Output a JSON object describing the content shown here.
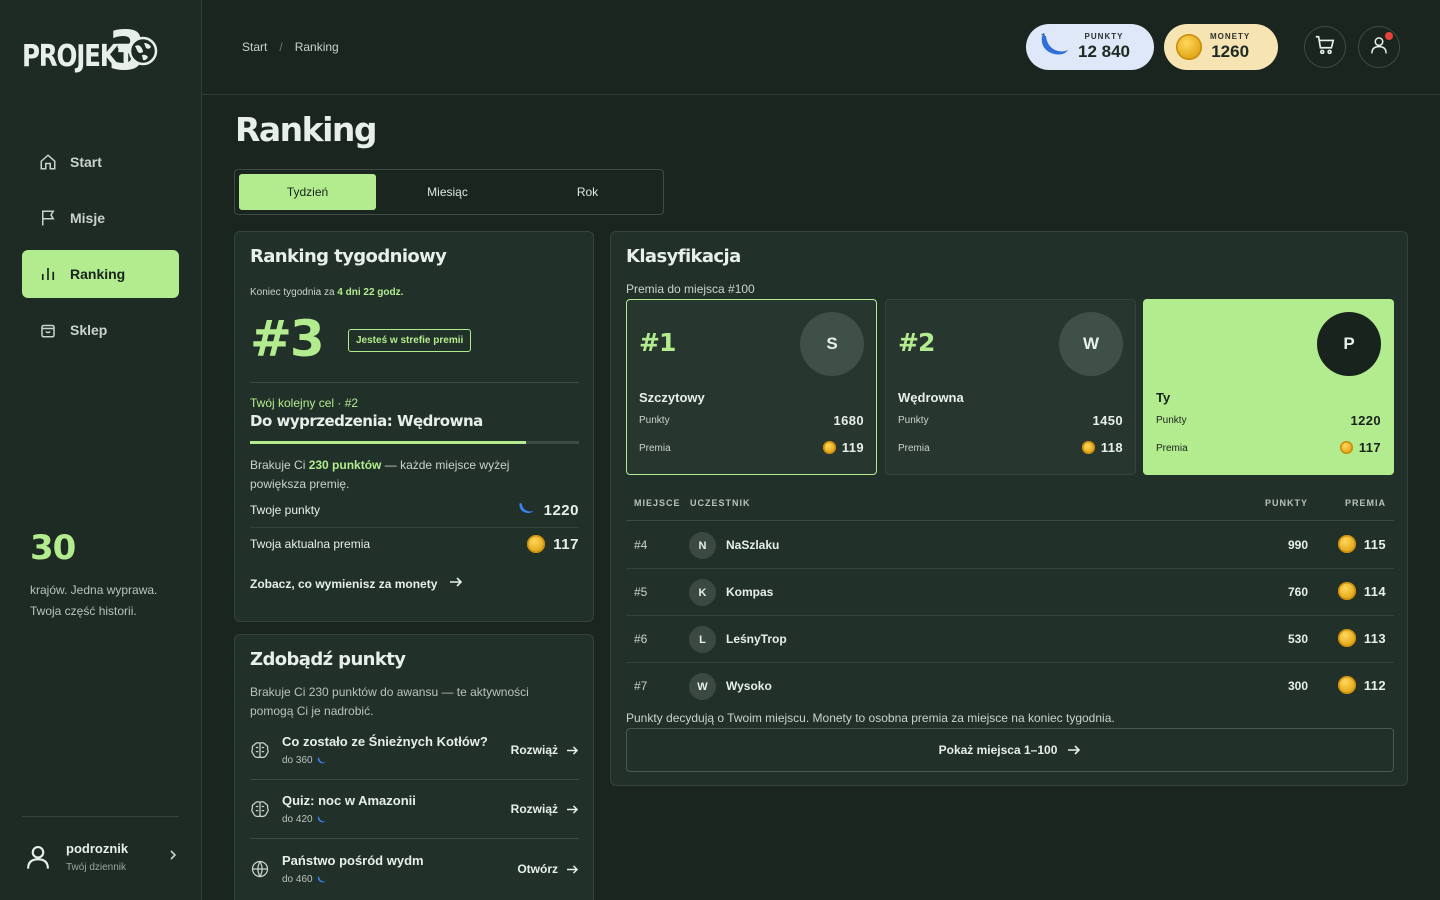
{
  "logo": {
    "text": "PROJEKT",
    "num": "3"
  },
  "nav": [
    {
      "label": "Start",
      "icon": "home-icon"
    },
    {
      "label": "Misje",
      "icon": "flag-icon"
    },
    {
      "label": "Ranking",
      "icon": "bar-chart-icon"
    },
    {
      "label": "Sklep",
      "icon": "shopping-bag-icon"
    }
  ],
  "promo": {
    "number": "30",
    "text": "krajów. Jedna wyprawa. Twoja część historii."
  },
  "user": {
    "name": "podroznik",
    "sub": "Twój dziennik"
  },
  "breadcrumb": {
    "home": "Start",
    "sep": "/",
    "current": "Ranking"
  },
  "wallet": {
    "points_label": "PUNKTY",
    "points": "12 840",
    "coins_label": "MONETY",
    "coins": "1260"
  },
  "page": {
    "title": "Ranking"
  },
  "tabs": [
    "Tydzień",
    "Miesiąc",
    "Rok"
  ],
  "weekly": {
    "title": "Ranking tygodniowy",
    "ends_prefix": "Koniec tygodnia za",
    "ends_value": "4 dni 22 godz.",
    "rank": "#3",
    "zone_badge": "Jesteś w strefie premii",
    "goal_label": "Twój kolejny cel · #2",
    "goal": "Do wyprzedzenia: Wędrowna",
    "progress": 0.84,
    "missing_prefix": "Brakuje Ci",
    "missing_value": "230 punktów",
    "missing_suffix": "— każde miejsce wyżej powiększa premię.",
    "points_label": "Twoje punkty",
    "points": "1220",
    "bonus_label": "Twoja aktualna premia",
    "bonus": "117",
    "link": "Zobacz, co wymienisz za monety"
  },
  "earn": {
    "title": "Zdobądź punkty",
    "desc": "Brakuje Ci 230 punktów do awansu — te aktywności pomogą Ci je nadrobić.",
    "tasks": [
      {
        "name": "Co zostało ze Śnieżnych Kotłów?",
        "reward": "do 360",
        "action": "Rozwiąż",
        "icon": "brain-icon"
      },
      {
        "name": "Quiz: noc w Amazonii",
        "reward": "do 420",
        "action": "Rozwiąż",
        "icon": "brain-icon"
      },
      {
        "name": "Państwo pośród wydm",
        "reward": "do 460",
        "action": "Otwórz",
        "icon": "globe-icon"
      }
    ]
  },
  "classification": {
    "title": "Klasyfikacja",
    "sub": "Premia do miejsca #100",
    "podium": [
      {
        "place": "#1",
        "initial": "S",
        "name": "Szczytowy",
        "points_label": "Punkty",
        "points": "1680",
        "bonus_label": "Premia",
        "bonus": "119"
      },
      {
        "place": "#2",
        "initial": "W",
        "name": "Wędrowna",
        "points_label": "Punkty",
        "points": "1450",
        "bonus_label": "Premia",
        "bonus": "118"
      },
      {
        "place": "",
        "initial": "P",
        "name": "Ty",
        "points_label": "Punkty",
        "points": "1220",
        "bonus_label": "Premia",
        "bonus": "117"
      }
    ],
    "columns": {
      "place": "MIEJSCE",
      "user": "UCZESTNIK",
      "points": "PUNKTY",
      "bonus": "PREMIA"
    },
    "rows": [
      {
        "place": "#4",
        "initial": "N",
        "name": "NaSzlaku",
        "points": "990",
        "bonus": "115"
      },
      {
        "place": "#5",
        "initial": "K",
        "name": "Kompas",
        "points": "760",
        "bonus": "114"
      },
      {
        "place": "#6",
        "initial": "L",
        "name": "LeśnyTrop",
        "points": "530",
        "bonus": "113"
      },
      {
        "place": "#7",
        "initial": "W",
        "name": "Wysoko",
        "points": "300",
        "bonus": "112"
      }
    ],
    "note": "Punkty decydują o Twoim miejscu. Monety to osobna premia za miejsce na koniec tygodnia.",
    "more": "Pokaż miejsca 1–100"
  },
  "colors": {
    "accent": "#b3ec8e",
    "bg": "#1a2520",
    "card": "#213029"
  }
}
